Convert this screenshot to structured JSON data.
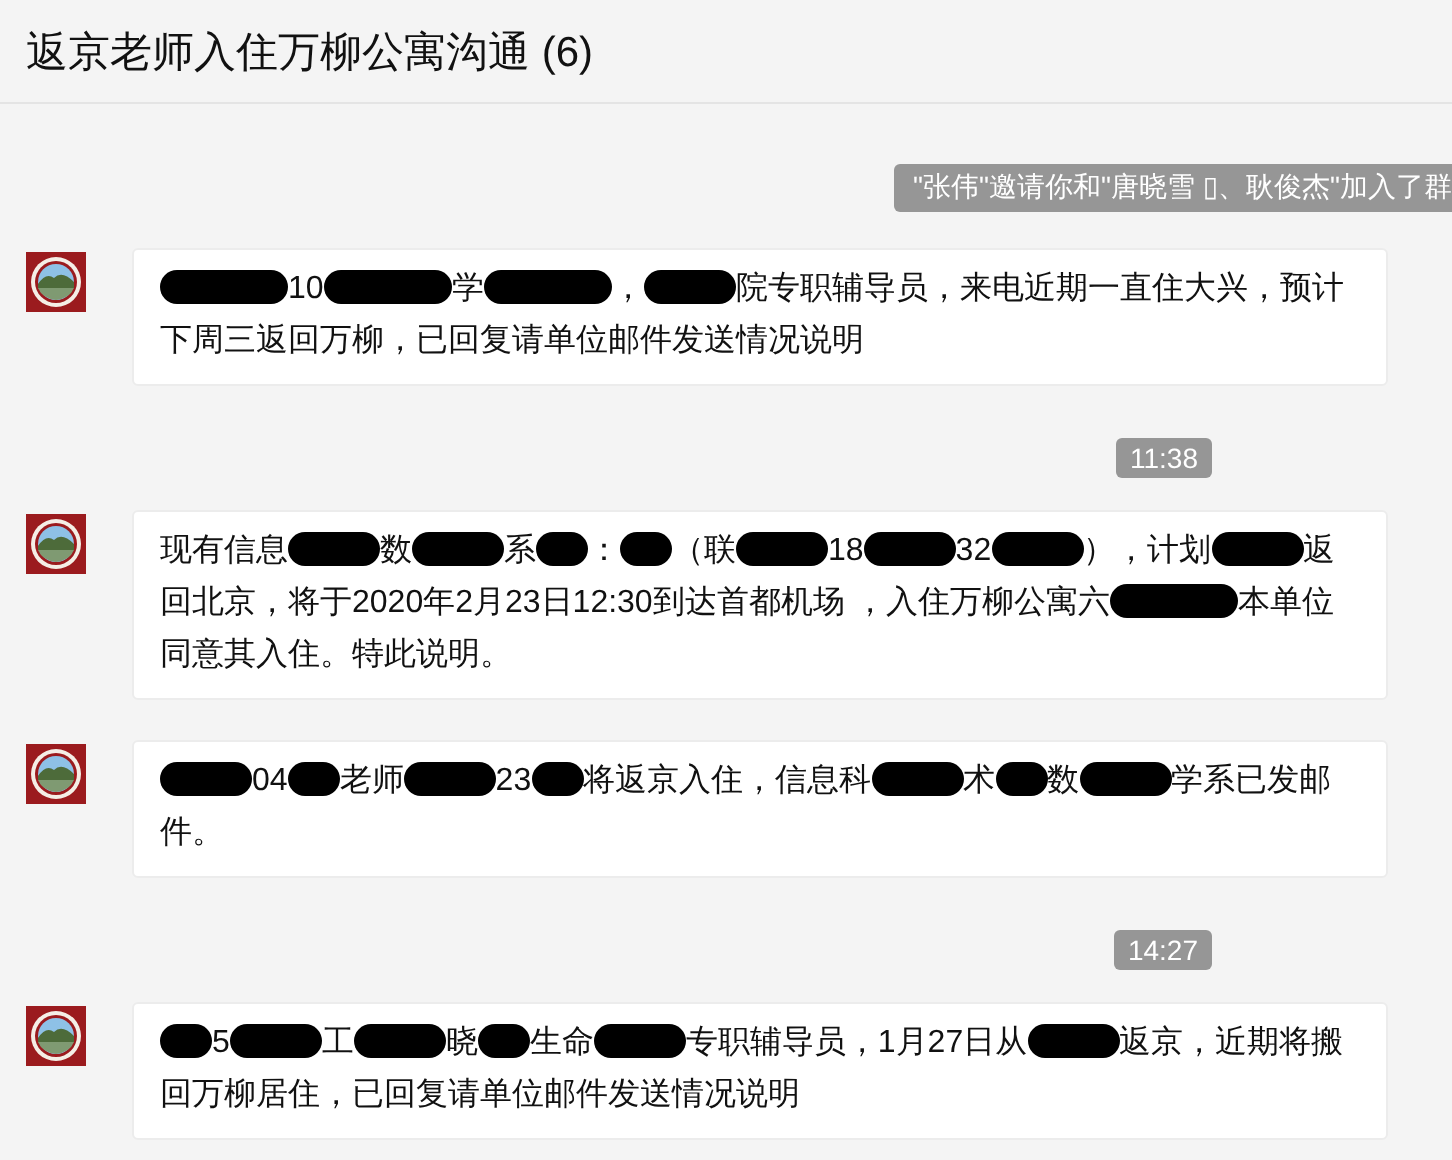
{
  "window": {
    "title": "返京老师入住万柳公寓沟通 (6)"
  },
  "messages": [
    {
      "kind": "notice",
      "text": "\"张伟\"邀请你和\"唐晓雪 ▯、耿俊杰\"加入了群"
    },
    {
      "kind": "message",
      "segments": [
        {
          "kind": "redaction_long"
        },
        {
          "kind": "text",
          "text": "10"
        },
        {
          "kind": "redaction_long"
        },
        {
          "kind": "text",
          "text": "学"
        },
        {
          "kind": "redaction_long"
        },
        {
          "kind": "text",
          "text": "，"
        },
        {
          "kind": "redaction_medium"
        },
        {
          "kind": "text",
          "text": "院专职辅导员，来电近期一直住大兴，预计下周三返回万柳，已回复请单位邮件发送情况说明"
        }
      ]
    },
    {
      "kind": "time",
      "text": "11:38"
    },
    {
      "kind": "message",
      "segments": [
        {
          "kind": "text",
          "text": "现有信息"
        },
        {
          "kind": "redaction_medium"
        },
        {
          "kind": "text",
          "text": "数"
        },
        {
          "kind": "redaction_medium"
        },
        {
          "kind": "text",
          "text": "系"
        },
        {
          "kind": "redaction_short"
        },
        {
          "kind": "text",
          "text": "："
        },
        {
          "kind": "redaction_short"
        },
        {
          "kind": "text",
          "text": "（联"
        },
        {
          "kind": "redaction_medium"
        },
        {
          "kind": "text",
          "text": "18"
        },
        {
          "kind": "redaction_medium"
        },
        {
          "kind": "text",
          "text": "32"
        },
        {
          "kind": "redaction_medium"
        },
        {
          "kind": "text",
          "text": "），计划"
        },
        {
          "kind": "redaction_medium"
        },
        {
          "kind": "text",
          "text": "返回北京，将于2020年2月23日12:30到达首都机场 ，入住万柳公寓六"
        },
        {
          "kind": "redaction_long"
        },
        {
          "kind": "text",
          "text": "本单位同意其入住。特此说明。"
        }
      ]
    },
    {
      "kind": "message",
      "segments": [
        {
          "kind": "redaction_medium"
        },
        {
          "kind": "text",
          "text": "04"
        },
        {
          "kind": "redaction_short"
        },
        {
          "kind": "text",
          "text": "老师"
        },
        {
          "kind": "redaction_medium"
        },
        {
          "kind": "text",
          "text": "23"
        },
        {
          "kind": "redaction_short"
        },
        {
          "kind": "text",
          "text": "将返京入住，信息科"
        },
        {
          "kind": "redaction_medium"
        },
        {
          "kind": "text",
          "text": "术"
        },
        {
          "kind": "redaction_short"
        },
        {
          "kind": "text",
          "text": "数"
        },
        {
          "kind": "redaction_medium"
        },
        {
          "kind": "text",
          "text": "学系已发邮件。"
        }
      ]
    },
    {
      "kind": "time",
      "text": "14:27"
    },
    {
      "kind": "message",
      "segments": [
        {
          "kind": "redaction_short"
        },
        {
          "kind": "text",
          "text": "5"
        },
        {
          "kind": "redaction_medium"
        },
        {
          "kind": "text",
          "text": "工"
        },
        {
          "kind": "redaction_medium"
        },
        {
          "kind": "text",
          "text": "晓"
        },
        {
          "kind": "redaction_short"
        },
        {
          "kind": "text",
          "text": "生命"
        },
        {
          "kind": "redaction_medium"
        },
        {
          "kind": "text",
          "text": "专职辅导员，1月27日从"
        },
        {
          "kind": "redaction_medium"
        },
        {
          "kind": "text",
          "text": "返京，近期将搬回万柳居住，已回复请单位邮件发送情况说明"
        }
      ]
    }
  ]
}
